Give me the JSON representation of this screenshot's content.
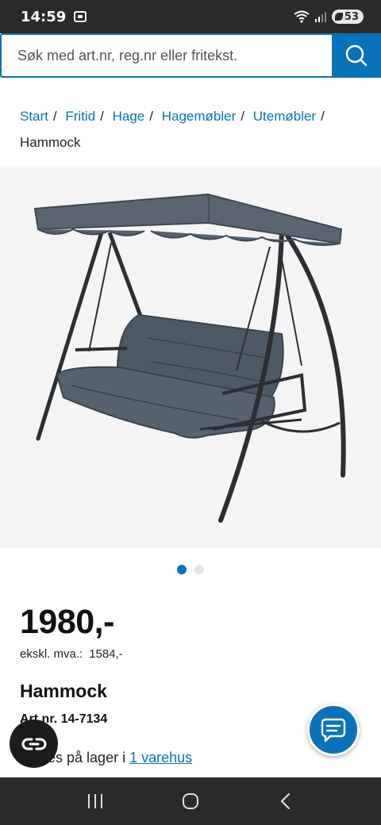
{
  "status_bar": {
    "time": "14:59",
    "battery": "53",
    "icons": [
      "screen-record-icon",
      "wifi-icon",
      "signal-icon",
      "battery-icon"
    ]
  },
  "search": {
    "placeholder": "Søk med art.nr, reg.nr eller fritekst.",
    "icon": "search-icon"
  },
  "breadcrumb": {
    "items": [
      "Start",
      "Fritid",
      "Hage",
      "Hagemøbler",
      "Utemøbler"
    ],
    "separator": "/",
    "current": "Hammock"
  },
  "gallery": {
    "image_count": 2,
    "active_index": 0,
    "image_subject": "hammock-swing-image"
  },
  "product": {
    "price": "1980,-",
    "vat_label": "ekskl. mva.:",
    "vat_value": "1584,-",
    "title": "Hammock",
    "art_nr": "Art.nr. 14-7134",
    "stock_text": "Finnes på lager i",
    "stock_link": "1 varehus"
  },
  "colors": {
    "brand_blue": "#0a72b9",
    "status_bar": "#2a2a2c"
  }
}
